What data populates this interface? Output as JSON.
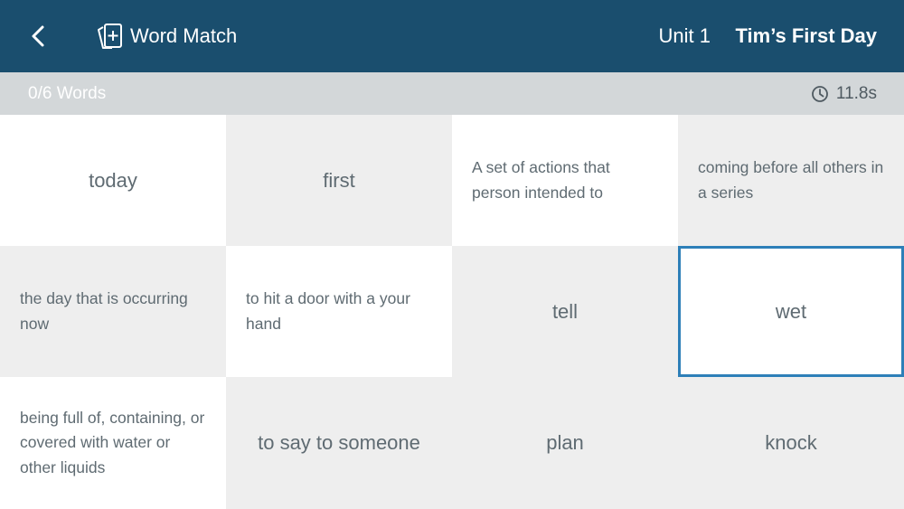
{
  "header": {
    "back_icon": "chevron-left-icon",
    "app_icon": "flashcard-add-icon",
    "app_title": "Word Match",
    "unit_label": "Unit 1",
    "lesson_title": "Tim’s First Day",
    "background_color": "#1a4e6e"
  },
  "status": {
    "progress_text": "0/6 Words",
    "timer_icon": "clock-icon",
    "timer_value": "11.8s"
  },
  "cards": [
    {
      "text": "today",
      "kind": "word",
      "shade": "white",
      "selected": false
    },
    {
      "text": "first",
      "kind": "word",
      "shade": "gray",
      "selected": false
    },
    {
      "text": "A set of actions that person intended to",
      "kind": "definition",
      "shade": "white",
      "selected": false
    },
    {
      "text": "coming before all others in a series",
      "kind": "definition",
      "shade": "gray",
      "selected": false
    },
    {
      "text": "the day that is occurring now",
      "kind": "definition",
      "shade": "gray",
      "selected": false
    },
    {
      "text": "to hit a door with a your hand",
      "kind": "definition",
      "shade": "white",
      "selected": false
    },
    {
      "text": "tell",
      "kind": "word",
      "shade": "gray",
      "selected": false
    },
    {
      "text": "wet",
      "kind": "word",
      "shade": "white",
      "selected": true
    },
    {
      "text": "being full of, containing, or covered with water or other liquids",
      "kind": "definition",
      "shade": "white",
      "selected": false
    },
    {
      "text": "to say to someone",
      "kind": "word",
      "shade": "gray",
      "selected": false
    },
    {
      "text": "plan",
      "kind": "word",
      "shade": "gray",
      "selected": false
    },
    {
      "text": "knock",
      "kind": "word",
      "shade": "gray",
      "selected": false
    }
  ],
  "colors": {
    "selected_border": "#2d7fb8",
    "card_gray": "#eeeeee",
    "status_bar": "#d3d7d9"
  }
}
